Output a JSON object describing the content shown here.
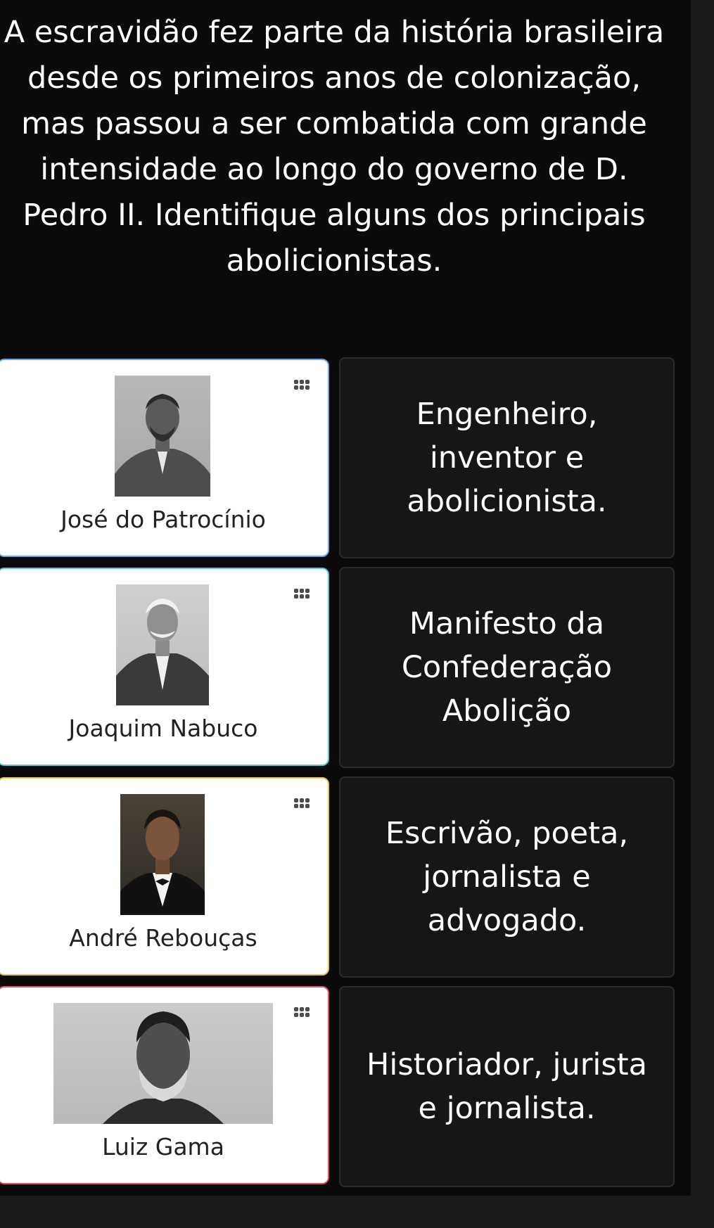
{
  "question": "A escravidão fez parte da história brasileira desde os primeiros anos de colonização, mas passou a ser combatida com grande intensidade ao longo do governo de D. Pedro II. Identifique alguns dos principais abolicionistas.",
  "cards": [
    {
      "name": "José do Patrocínio",
      "border_color": "#6aa7e8",
      "portrait_icon": "portrait-jose-do-patrocinio"
    },
    {
      "name": "Joaquim Nabuco",
      "border_color": "#58c7d8",
      "portrait_icon": "portrait-joaquim-nabuco"
    },
    {
      "name": "André Rebouças",
      "border_color": "#f0c35a",
      "portrait_icon": "portrait-andre-reboucas"
    },
    {
      "name": "Luiz Gama",
      "border_color": "#e0506e",
      "portrait_icon": "portrait-luiz-gama"
    }
  ],
  "descriptions": [
    "Engenheiro, inventor e abolicionista.",
    "Manifesto da Confederação Abolição",
    "Escrivão, poeta, jornalista e advogado.",
    "Historiador, jurista e jornalista."
  ],
  "colors": {
    "background": "#0b0b0b",
    "card_background": "#ffffff",
    "description_background": "#161616"
  }
}
